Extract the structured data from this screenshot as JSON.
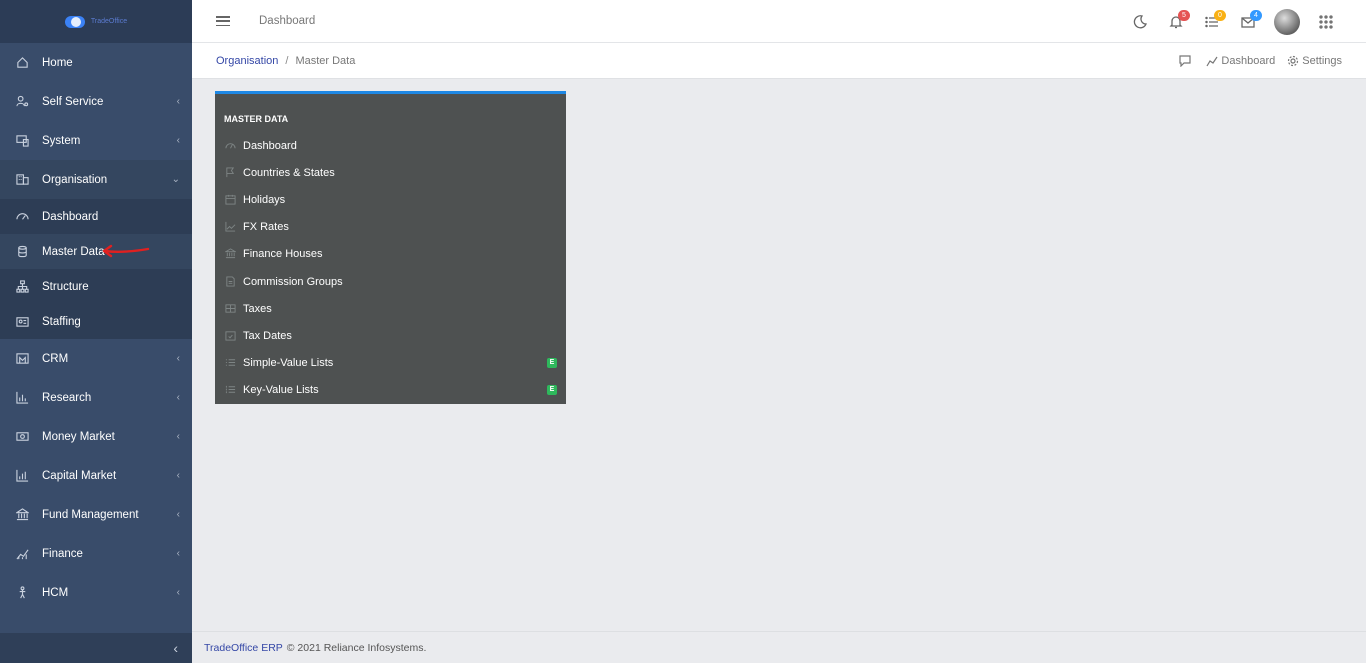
{
  "brand": {
    "logo_text": "TradeOffice"
  },
  "sidebar": {
    "items": [
      {
        "label": "Home",
        "icon": "home-icon",
        "chevron": ""
      },
      {
        "label": "Self Service",
        "icon": "user-cog-icon",
        "chevron": "‹"
      },
      {
        "label": "System",
        "icon": "devices-icon",
        "chevron": "‹"
      },
      {
        "label": "Organisation",
        "icon": "building-icon",
        "chevron": "⌄"
      }
    ],
    "organisation_sub": [
      {
        "label": "Dashboard",
        "icon": "speedometer-icon"
      },
      {
        "label": "Master Data",
        "icon": "database-icon"
      },
      {
        "label": "Structure",
        "icon": "sitemap-icon"
      },
      {
        "label": "Staffing",
        "icon": "id-card-icon"
      }
    ],
    "items_after": [
      {
        "label": "CRM",
        "icon": "crm-icon",
        "chevron": "‹"
      },
      {
        "label": "Research",
        "icon": "chart-icon",
        "chevron": "‹"
      },
      {
        "label": "Money Market",
        "icon": "money-icon",
        "chevron": "‹"
      },
      {
        "label": "Capital Market",
        "icon": "bar-chart-icon",
        "chevron": "‹"
      },
      {
        "label": "Fund Management",
        "icon": "bank-icon",
        "chevron": "‹"
      },
      {
        "label": "Finance",
        "icon": "finance-icon",
        "chevron": "‹"
      },
      {
        "label": "HCM",
        "icon": "person-icon",
        "chevron": "‹"
      }
    ],
    "collapse_glyph": "‹"
  },
  "header": {
    "title": "Dashboard",
    "notifications_count": "5",
    "tasks_count": "0",
    "messages_count": "4",
    "colors": {
      "notif": "#e55353",
      "tasks": "#f9b115",
      "messages": "#3399ff"
    }
  },
  "breadcrumb": {
    "parent": "Organisation",
    "separator": "/",
    "current": "Master Data",
    "actions": {
      "dashboard": "Dashboard",
      "settings": "Settings"
    }
  },
  "panel": {
    "title": "MASTER DATA",
    "accent": "#1e88e5",
    "items": [
      {
        "label": "Dashboard",
        "icon": "speedometer-icon",
        "badge": ""
      },
      {
        "label": "Countries & States",
        "icon": "flag-icon",
        "badge": ""
      },
      {
        "label": "Holidays",
        "icon": "calendar-icon",
        "badge": ""
      },
      {
        "label": "FX Rates",
        "icon": "line-chart-icon",
        "badge": ""
      },
      {
        "label": "Finance Houses",
        "icon": "bank-icon",
        "badge": ""
      },
      {
        "label": "Commission Groups",
        "icon": "document-icon",
        "badge": ""
      },
      {
        "label": "Taxes",
        "icon": "table-icon",
        "badge": ""
      },
      {
        "label": "Tax Dates",
        "icon": "calendar-check-icon",
        "badge": ""
      },
      {
        "label": "Simple-Value Lists",
        "icon": "list-icon",
        "badge": "E"
      },
      {
        "label": "Key-Value Lists",
        "icon": "list-ordered-icon",
        "badge": "E"
      }
    ]
  },
  "footer": {
    "link": "TradeOffice ERP",
    "text": "© 2021 Reliance Infosystems."
  }
}
